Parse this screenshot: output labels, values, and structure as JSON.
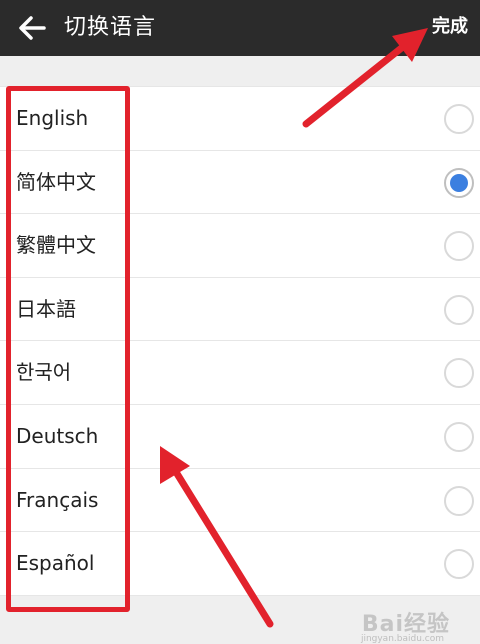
{
  "header": {
    "title": "切换语言",
    "done_label": "完成"
  },
  "languages": [
    {
      "label": "English",
      "selected": false
    },
    {
      "label": "简体中文",
      "selected": true
    },
    {
      "label": "繁體中文",
      "selected": false
    },
    {
      "label": "日本語",
      "selected": false
    },
    {
      "label": "한국어",
      "selected": false
    },
    {
      "label": "Deutsch",
      "selected": false
    },
    {
      "label": "Français",
      "selected": false
    },
    {
      "label": "Español",
      "selected": false
    }
  ],
  "watermark": {
    "text": "Bai经验",
    "sub": "jingyan.baidu.com"
  },
  "colors": {
    "topbar": "#2b2b2b",
    "accent": "#3b7fe0",
    "annotation": "#e2222c"
  }
}
